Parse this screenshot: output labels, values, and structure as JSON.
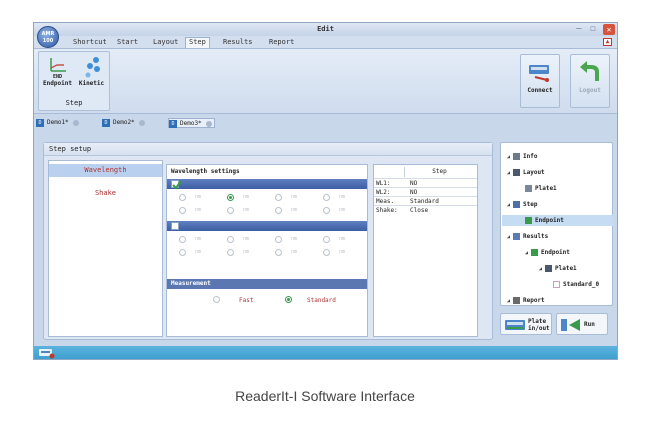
{
  "window": {
    "title": "Edit",
    "logo_text": "AMR 100"
  },
  "menu": {
    "tabs": [
      "Shortcut",
      "Start",
      "Layout",
      "Step",
      "Results",
      "Report"
    ],
    "active": "Step"
  },
  "ribbon": {
    "group_label": "Step",
    "endpoint_label": "Endpoint",
    "endpoint_icon_text": "END",
    "kinetic_label": "Kinetic",
    "connect_label": "Connect",
    "logout_label": "Logout"
  },
  "doc_tabs": [
    "Demo1*",
    "Demo2*",
    "Demo3*"
  ],
  "step_setup": {
    "title": "Step setup",
    "nav": [
      "Wavelength",
      "Shake"
    ],
    "settings_title": "Wavelength settings",
    "radio_label": "nm",
    "measurement_title": "Measurement",
    "measurement_options": [
      "Fast",
      "Standard"
    ],
    "measurement_selected": "Standard"
  },
  "summary": {
    "header": "Step",
    "rows": [
      {
        "key": "WL1:",
        "value": "NO"
      },
      {
        "key": "WL2:",
        "value": "NO"
      },
      {
        "key": "Meas.",
        "value": "Standard"
      },
      {
        "key": "Shake:",
        "value": "Close"
      }
    ]
  },
  "tree": {
    "items": [
      "Info",
      "Layout",
      "Plate1",
      "Step",
      "Endpoint",
      "Results",
      "Endpoint",
      "Plate1",
      "Standard_0",
      "Report"
    ],
    "selected_index": 4
  },
  "buttons": {
    "plate_inout": "Plate in/out",
    "run": "Run"
  },
  "caption": "ReaderIt-I Software Interface"
}
